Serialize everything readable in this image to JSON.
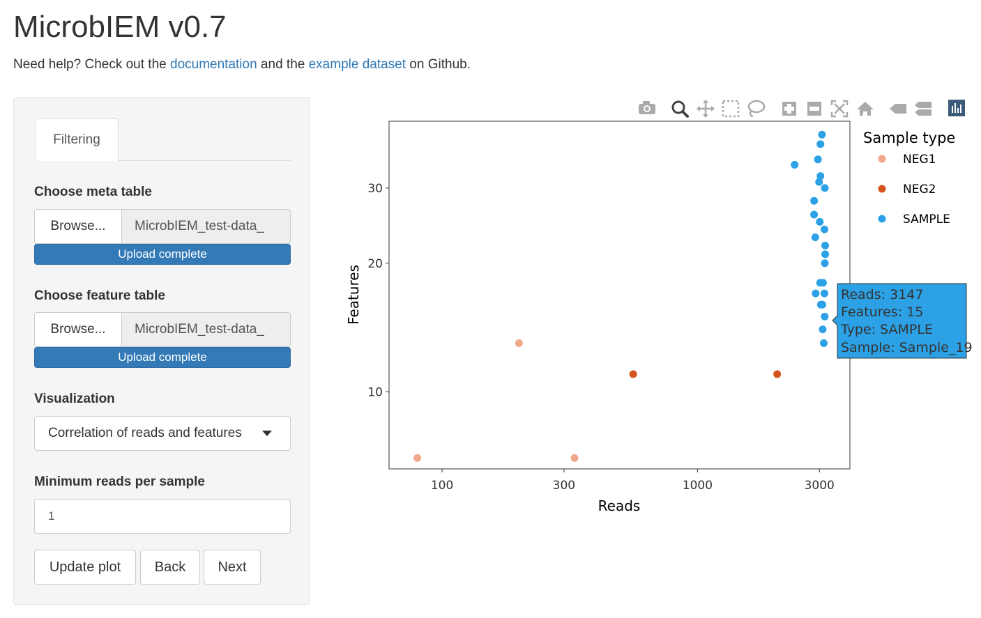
{
  "app": {
    "title": "MicrobIEM v0.7",
    "help_prefix": "Need help? Check out the ",
    "help_link1": "documentation",
    "help_middle": " and the ",
    "help_link2": "example dataset",
    "help_suffix": " on Github."
  },
  "sidebar": {
    "tab_label": "Filtering",
    "meta_label": "Choose meta table",
    "meta_browse": "Browse...",
    "meta_filename": "MicrobIEM_test-data_",
    "meta_status": "Upload complete",
    "feature_label": "Choose feature table",
    "feature_browse": "Browse...",
    "feature_filename": "MicrobIEM_test-data_",
    "feature_status": "Upload complete",
    "viz_label": "Visualization",
    "viz_selected": "Correlation of reads and features",
    "minreads_label": "Minimum reads per sample",
    "minreads_value": "1",
    "buttons": {
      "update": "Update plot",
      "back": "Back",
      "next": "Next"
    }
  },
  "toolbar": {
    "icons": [
      "camera-icon",
      "zoom-icon",
      "pan-icon",
      "box-select-icon",
      "lasso-select-icon",
      "zoom-in-icon",
      "zoom-out-icon",
      "autoscale-icon",
      "reset-axes-icon",
      "hover-closest-icon",
      "hover-compare-icon",
      "plotly-logo-icon"
    ]
  },
  "tooltip": {
    "lines": [
      "Reads: 3147",
      "Features: 15",
      "Type: SAMPLE",
      "Sample: Sample_19"
    ],
    "color": "#2ca1e6"
  },
  "chart_data": {
    "type": "scatter",
    "xlabel": "Reads",
    "ylabel": "Features",
    "x_scale": "log",
    "y_scale": "log",
    "xlim": [
      62,
      3950
    ],
    "ylim": [
      6.6,
      43
    ],
    "x_ticks": [
      100,
      300,
      1000,
      3000
    ],
    "x_tick_labels": [
      "100",
      "300",
      "1000",
      "3000"
    ],
    "y_ticks": [
      10,
      20,
      30
    ],
    "y_tick_labels": [
      "10",
      "20",
      "30"
    ],
    "legend_title": "Sample type",
    "legend_position": "right",
    "series": [
      {
        "name": "NEG1",
        "color": "#f0a78a",
        "points": [
          [
            80,
            7
          ],
          [
            200,
            13
          ],
          [
            330,
            7
          ]
        ]
      },
      {
        "name": "NEG2",
        "color": "#d4541d",
        "points": [
          [
            560,
            11
          ],
          [
            2050,
            11
          ]
        ]
      },
      {
        "name": "SAMPLE",
        "color": "#2ca1e6",
        "points": [
          [
            3070,
            40
          ],
          [
            3030,
            38
          ],
          [
            2960,
            35
          ],
          [
            2400,
            34
          ],
          [
            3030,
            32
          ],
          [
            2990,
            31
          ],
          [
            3150,
            30
          ],
          [
            2860,
            28
          ],
          [
            2860,
            26
          ],
          [
            3010,
            25
          ],
          [
            3140,
            24
          ],
          [
            2890,
            23
          ],
          [
            3160,
            22
          ],
          [
            3160,
            21
          ],
          [
            3150,
            20
          ],
          [
            3100,
            18
          ],
          [
            3020,
            18
          ],
          [
            2900,
            17
          ],
          [
            3140,
            17
          ],
          [
            3080,
            16
          ],
          [
            3040,
            16
          ],
          [
            3147,
            15
          ],
          [
            3090,
            14
          ],
          [
            3120,
            13
          ]
        ]
      }
    ]
  }
}
